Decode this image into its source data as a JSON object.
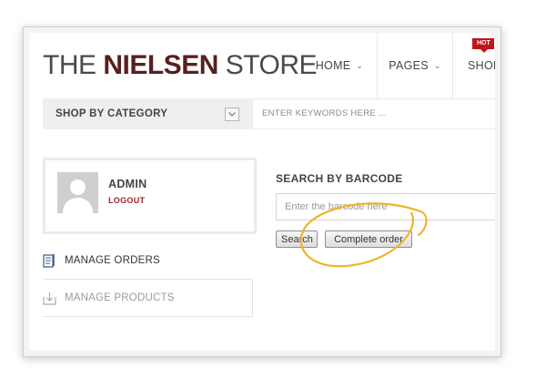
{
  "header": {
    "logo_prefix": "THE ",
    "logo_strong": "NIELSEN",
    "logo_suffix": " STORE",
    "nav": [
      {
        "label": "HOME"
      },
      {
        "label": "PAGES"
      },
      {
        "label": "SHOP"
      }
    ],
    "hot_badge": "HOT"
  },
  "category_bar": {
    "label": "SHOP BY CATEGORY",
    "toggle_icon": "chevron-down-icon"
  },
  "search": {
    "placeholder": "ENTER KEYWORDS HERE ..."
  },
  "user": {
    "name": "ADMIN",
    "logout_label": "LOGOUT"
  },
  "side_menu": [
    {
      "label": "MANAGE ORDERS",
      "icon": "orders-list-icon"
    },
    {
      "label": "MANAGE PRODUCTS",
      "icon": "download-box-icon"
    }
  ],
  "barcode": {
    "title": "SEARCH BY BARCODE",
    "placeholder": "Enter the barcode here",
    "search_label": "Search",
    "complete_label": "Complete order"
  },
  "annotation": {
    "color": "#f0b429"
  }
}
